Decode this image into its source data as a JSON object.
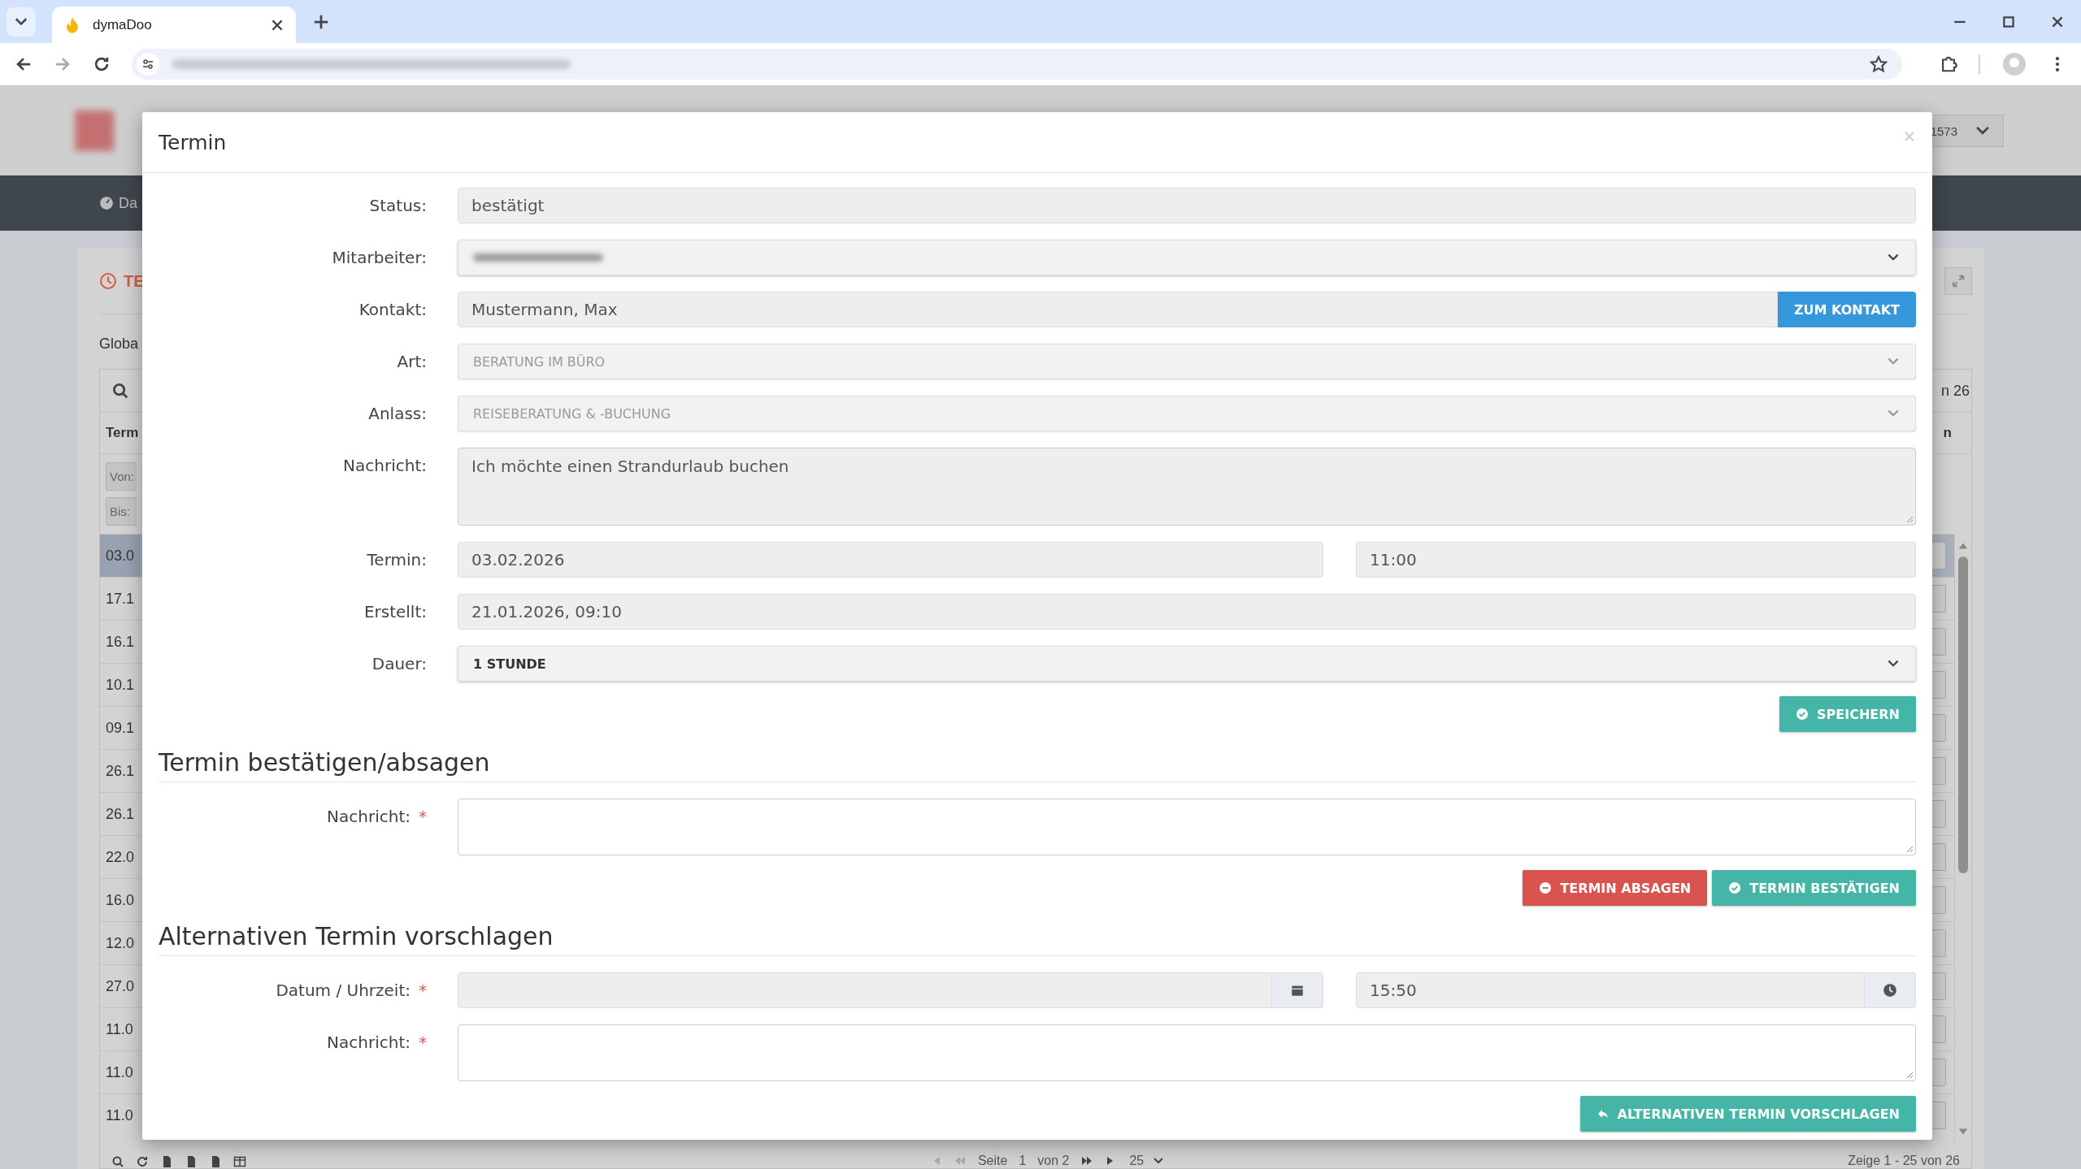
{
  "browser": {
    "tab": {
      "title": "dymaDoo"
    }
  },
  "background": {
    "header": {
      "account": "1573"
    },
    "nav": {
      "item": "Da"
    },
    "card": {
      "title": "TE",
      "filter_label": "Globa",
      "column_header": "Term",
      "from_filter": "Von:",
      "to_filter": "Bis:",
      "count_text": "n 26",
      "right_header": "n",
      "rows": [
        {
          "date": "03.0",
          "selected": true
        },
        {
          "date": "17.1",
          "selected": false
        },
        {
          "date": "16.1",
          "selected": false
        },
        {
          "date": "10.1",
          "selected": false
        },
        {
          "date": "09.1",
          "selected": false
        },
        {
          "date": "26.1",
          "selected": false
        },
        {
          "date": "26.1",
          "selected": false
        },
        {
          "date": "22.0",
          "selected": false
        },
        {
          "date": "16.0",
          "selected": false
        },
        {
          "date": "12.0",
          "selected": false
        },
        {
          "date": "27.0",
          "selected": false
        },
        {
          "date": "11.0",
          "selected": false
        },
        {
          "date": "11.0",
          "selected": false
        },
        {
          "date": "11.0",
          "selected": false
        }
      ]
    },
    "pager": {
      "page_label": "Seite",
      "page": "1",
      "of_pages": "von 2",
      "page_size": "25",
      "summary": "Zeige 1 - 25 von 26"
    }
  },
  "dialog": {
    "title": "Termin",
    "form": {
      "fields": [
        {
          "kind": "text",
          "label": "Status:",
          "value": "bestätigt"
        },
        {
          "kind": "select",
          "label": "Mitarbeiter:",
          "disabled": false
        },
        {
          "kind": "text_button",
          "label": "Kontakt:",
          "value": "Mustermann, Max",
          "button": "ZUM KONTAKT"
        },
        {
          "kind": "select",
          "label": "Art:",
          "value": "BERATUNG IM BÜRO",
          "disabled": true
        },
        {
          "kind": "select",
          "label": "Anlass:",
          "value": "REISEBERATUNG & -BUCHUNG",
          "disabled": true
        },
        {
          "kind": "textarea",
          "label": "Nachricht:",
          "value": "Ich möchte einen Strandurlaub buchen"
        },
        {
          "kind": "date_time",
          "label": "Termin:",
          "date": "03.02.2026",
          "time": "11:00"
        },
        {
          "kind": "text",
          "label": "Erstellt:",
          "value": "21.01.2026, 09:10"
        },
        {
          "kind": "select",
          "label": "Dauer:",
          "value": "1 STUNDE",
          "disabled": false
        }
      ],
      "buttons": [
        {
          "label": "SPEICHERN",
          "kind": "success"
        }
      ]
    },
    "sections": [
      {
        "title": "Termin bestätigen/absagen",
        "fields": [
          {
            "kind": "textarea",
            "label": "Nachricht:",
            "required_mark": "*"
          }
        ],
        "buttons": [
          {
            "label": "TERMIN ABSAGEN",
            "kind": "danger"
          },
          {
            "label": "TERMIN BESTÄTIGEN",
            "kind": "success"
          }
        ]
      },
      {
        "title": "Alternativen Termin vorschlagen",
        "fields": [
          {
            "kind": "date_time_picker",
            "label": "Datum / Uhrzeit:",
            "required_mark": "*",
            "time": "15:50"
          },
          {
            "kind": "textarea",
            "label": "Nachricht:",
            "required_mark": "*"
          }
        ],
        "buttons": [
          {
            "label": "ALTERNATIVEN TERMIN VORSCHLAGEN",
            "kind": "success"
          }
        ]
      }
    ]
  }
}
